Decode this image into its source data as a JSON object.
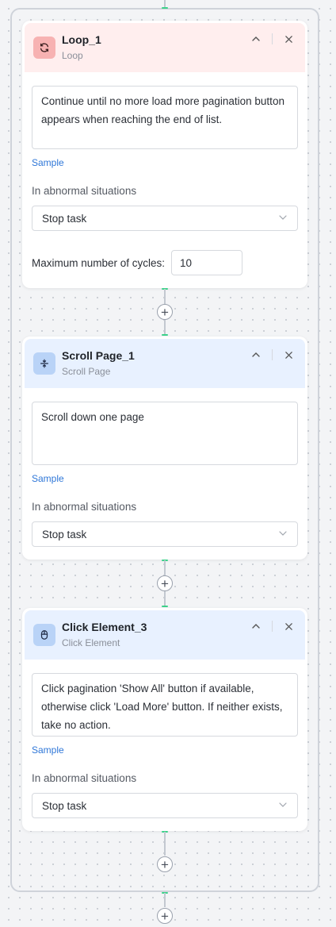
{
  "loop": {
    "title": "Loop_1",
    "subtitle": "Loop",
    "description": "Continue until no more load more pagination button appears when reaching the end of list.",
    "sample_label": "Sample",
    "abnormal_label": "In abnormal situations",
    "abnormal_value": "Stop task",
    "max_cycles_label": "Maximum number of cycles:",
    "max_cycles_value": "10"
  },
  "scroll": {
    "title": "Scroll Page_1",
    "subtitle": "Scroll Page",
    "description": "Scroll down one page",
    "sample_label": "Sample",
    "abnormal_label": "In abnormal situations",
    "abnormal_value": "Stop task"
  },
  "click": {
    "title": "Click Element_3",
    "subtitle": "Click Element",
    "description": "Click pagination 'Show All' button if available, otherwise click 'Load More' button. If neither exists, take no action.",
    "sample_label": "Sample",
    "abnormal_label": "In abnormal situations",
    "abnormal_value": "Stop task"
  },
  "icons": {
    "loop": "refresh-icon",
    "scroll": "scroll-vertical-icon",
    "click": "mouse-icon",
    "collapse": "chevron-up-icon",
    "close": "close-icon",
    "dropdown": "chevron-down-icon",
    "add": "plus-icon"
  },
  "colors": {
    "connector_accent": "#3dd28b",
    "loop_header": "#ffeeee",
    "action_header": "#e8f1ff",
    "link": "#2f77d8"
  }
}
